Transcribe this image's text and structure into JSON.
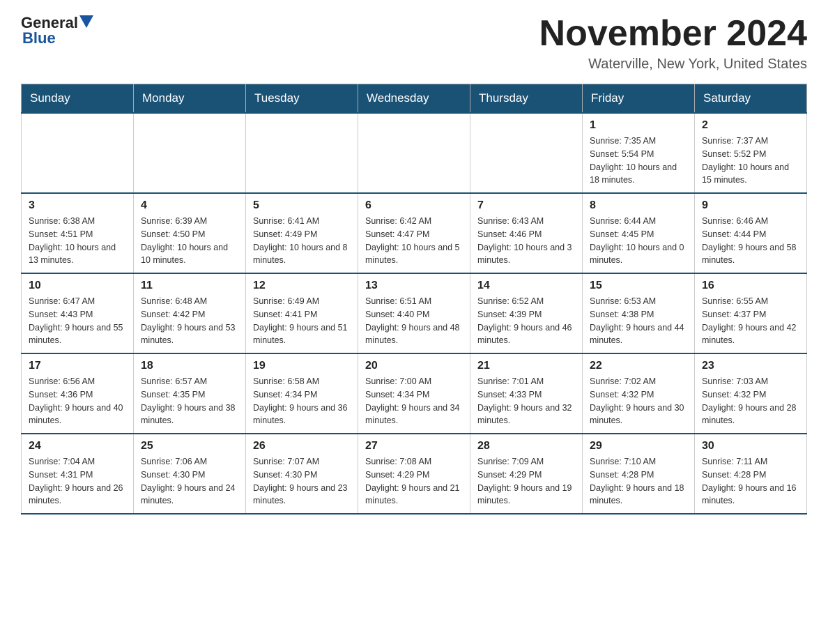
{
  "header": {
    "logo_text1": "General",
    "logo_text2": "Blue",
    "month": "November 2024",
    "location": "Waterville, New York, United States"
  },
  "days_of_week": [
    "Sunday",
    "Monday",
    "Tuesday",
    "Wednesday",
    "Thursday",
    "Friday",
    "Saturday"
  ],
  "weeks": [
    [
      {
        "day": "",
        "info": ""
      },
      {
        "day": "",
        "info": ""
      },
      {
        "day": "",
        "info": ""
      },
      {
        "day": "",
        "info": ""
      },
      {
        "day": "",
        "info": ""
      },
      {
        "day": "1",
        "info": "Sunrise: 7:35 AM\nSunset: 5:54 PM\nDaylight: 10 hours and 18 minutes."
      },
      {
        "day": "2",
        "info": "Sunrise: 7:37 AM\nSunset: 5:52 PM\nDaylight: 10 hours and 15 minutes."
      }
    ],
    [
      {
        "day": "3",
        "info": "Sunrise: 6:38 AM\nSunset: 4:51 PM\nDaylight: 10 hours and 13 minutes."
      },
      {
        "day": "4",
        "info": "Sunrise: 6:39 AM\nSunset: 4:50 PM\nDaylight: 10 hours and 10 minutes."
      },
      {
        "day": "5",
        "info": "Sunrise: 6:41 AM\nSunset: 4:49 PM\nDaylight: 10 hours and 8 minutes."
      },
      {
        "day": "6",
        "info": "Sunrise: 6:42 AM\nSunset: 4:47 PM\nDaylight: 10 hours and 5 minutes."
      },
      {
        "day": "7",
        "info": "Sunrise: 6:43 AM\nSunset: 4:46 PM\nDaylight: 10 hours and 3 minutes."
      },
      {
        "day": "8",
        "info": "Sunrise: 6:44 AM\nSunset: 4:45 PM\nDaylight: 10 hours and 0 minutes."
      },
      {
        "day": "9",
        "info": "Sunrise: 6:46 AM\nSunset: 4:44 PM\nDaylight: 9 hours and 58 minutes."
      }
    ],
    [
      {
        "day": "10",
        "info": "Sunrise: 6:47 AM\nSunset: 4:43 PM\nDaylight: 9 hours and 55 minutes."
      },
      {
        "day": "11",
        "info": "Sunrise: 6:48 AM\nSunset: 4:42 PM\nDaylight: 9 hours and 53 minutes."
      },
      {
        "day": "12",
        "info": "Sunrise: 6:49 AM\nSunset: 4:41 PM\nDaylight: 9 hours and 51 minutes."
      },
      {
        "day": "13",
        "info": "Sunrise: 6:51 AM\nSunset: 4:40 PM\nDaylight: 9 hours and 48 minutes."
      },
      {
        "day": "14",
        "info": "Sunrise: 6:52 AM\nSunset: 4:39 PM\nDaylight: 9 hours and 46 minutes."
      },
      {
        "day": "15",
        "info": "Sunrise: 6:53 AM\nSunset: 4:38 PM\nDaylight: 9 hours and 44 minutes."
      },
      {
        "day": "16",
        "info": "Sunrise: 6:55 AM\nSunset: 4:37 PM\nDaylight: 9 hours and 42 minutes."
      }
    ],
    [
      {
        "day": "17",
        "info": "Sunrise: 6:56 AM\nSunset: 4:36 PM\nDaylight: 9 hours and 40 minutes."
      },
      {
        "day": "18",
        "info": "Sunrise: 6:57 AM\nSunset: 4:35 PM\nDaylight: 9 hours and 38 minutes."
      },
      {
        "day": "19",
        "info": "Sunrise: 6:58 AM\nSunset: 4:34 PM\nDaylight: 9 hours and 36 minutes."
      },
      {
        "day": "20",
        "info": "Sunrise: 7:00 AM\nSunset: 4:34 PM\nDaylight: 9 hours and 34 minutes."
      },
      {
        "day": "21",
        "info": "Sunrise: 7:01 AM\nSunset: 4:33 PM\nDaylight: 9 hours and 32 minutes."
      },
      {
        "day": "22",
        "info": "Sunrise: 7:02 AM\nSunset: 4:32 PM\nDaylight: 9 hours and 30 minutes."
      },
      {
        "day": "23",
        "info": "Sunrise: 7:03 AM\nSunset: 4:32 PM\nDaylight: 9 hours and 28 minutes."
      }
    ],
    [
      {
        "day": "24",
        "info": "Sunrise: 7:04 AM\nSunset: 4:31 PM\nDaylight: 9 hours and 26 minutes."
      },
      {
        "day": "25",
        "info": "Sunrise: 7:06 AM\nSunset: 4:30 PM\nDaylight: 9 hours and 24 minutes."
      },
      {
        "day": "26",
        "info": "Sunrise: 7:07 AM\nSunset: 4:30 PM\nDaylight: 9 hours and 23 minutes."
      },
      {
        "day": "27",
        "info": "Sunrise: 7:08 AM\nSunset: 4:29 PM\nDaylight: 9 hours and 21 minutes."
      },
      {
        "day": "28",
        "info": "Sunrise: 7:09 AM\nSunset: 4:29 PM\nDaylight: 9 hours and 19 minutes."
      },
      {
        "day": "29",
        "info": "Sunrise: 7:10 AM\nSunset: 4:28 PM\nDaylight: 9 hours and 18 minutes."
      },
      {
        "day": "30",
        "info": "Sunrise: 7:11 AM\nSunset: 4:28 PM\nDaylight: 9 hours and 16 minutes."
      }
    ]
  ]
}
